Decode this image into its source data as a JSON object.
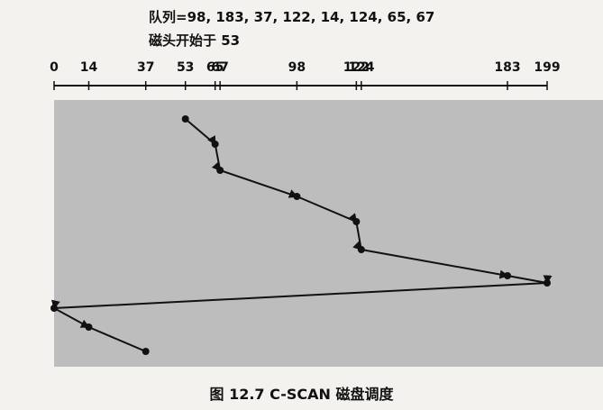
{
  "diagram": {
    "queue_text": "队列=98, 183, 37, 122, 14, 124, 65, 67",
    "head_text": "磁头开始于  53",
    "axis_labels": [
      0,
      14,
      37,
      53,
      65,
      67,
      98,
      122,
      124,
      183,
      199
    ],
    "caption": "图 12.7   C-SCAN 磁盘调度"
  },
  "theme": {
    "background": "#f3f2ef",
    "graph_fill": "#bdbdbd",
    "line_color": "#111111"
  }
}
